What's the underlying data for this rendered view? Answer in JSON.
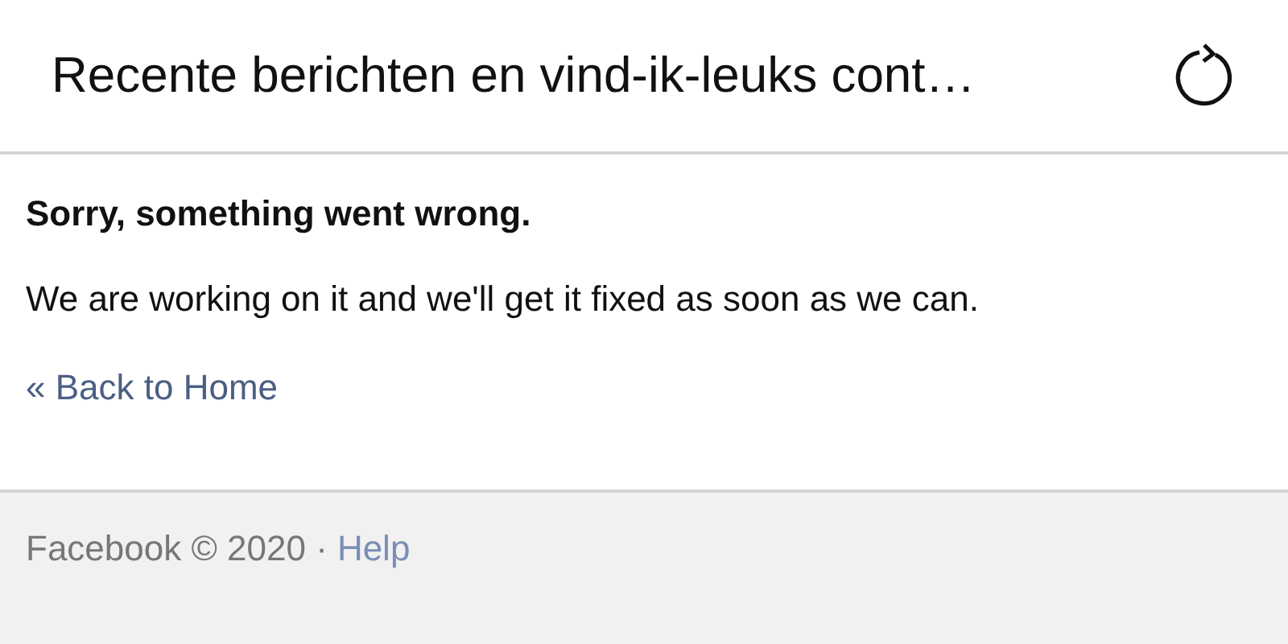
{
  "header": {
    "title": "Recente berichten en vind-ik-leuks cont…"
  },
  "error": {
    "heading": "Sorry, something went wrong.",
    "message": "We are working on it and we'll get it fixed as soon as we can.",
    "back_link": "« Back to Home"
  },
  "footer": {
    "copyright": "Facebook © 2020 ·",
    "help_link": "Help"
  }
}
